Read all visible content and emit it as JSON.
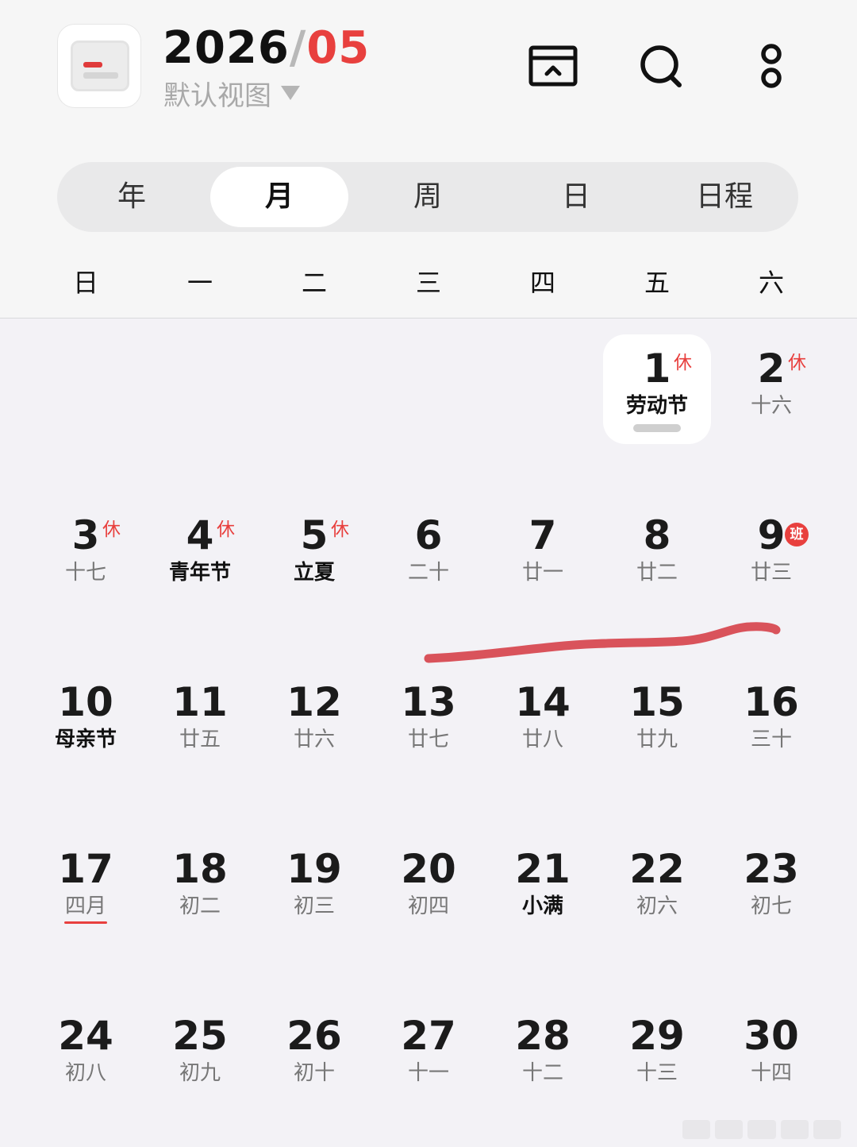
{
  "header": {
    "year": "2026",
    "separator": "/",
    "month": "05",
    "view_label": "默认视图",
    "buttons": [
      {
        "name": "collapse-icon"
      },
      {
        "name": "search-icon"
      },
      {
        "name": "more-icon"
      }
    ]
  },
  "view_tabs": [
    {
      "label": "年",
      "active": false
    },
    {
      "label": "月",
      "active": true
    },
    {
      "label": "周",
      "active": false
    },
    {
      "label": "日",
      "active": false
    },
    {
      "label": "日程",
      "active": false
    }
  ],
  "weekdays": [
    "日",
    "一",
    "二",
    "三",
    "四",
    "五",
    "六"
  ],
  "days": [
    {
      "day": "1",
      "sub": "劳动节",
      "badge": "休",
      "festival": true,
      "selected": true
    },
    {
      "day": "2",
      "sub": "十六",
      "badge": "休"
    },
    {
      "day": "3",
      "sub": "十七",
      "badge": "休"
    },
    {
      "day": "4",
      "sub": "青年节",
      "badge": "休",
      "festival": true
    },
    {
      "day": "5",
      "sub": "立夏",
      "badge": "休",
      "festival": true
    },
    {
      "day": "6",
      "sub": "二十"
    },
    {
      "day": "7",
      "sub": "廿一"
    },
    {
      "day": "8",
      "sub": "廿二"
    },
    {
      "day": "9",
      "sub": "廿三",
      "badge": "班",
      "badge_type": "ban"
    },
    {
      "day": "10",
      "sub": "母亲节",
      "festival": true
    },
    {
      "day": "11",
      "sub": "廿五"
    },
    {
      "day": "12",
      "sub": "廿六"
    },
    {
      "day": "13",
      "sub": "廿七"
    },
    {
      "day": "14",
      "sub": "廿八"
    },
    {
      "day": "15",
      "sub": "廿九"
    },
    {
      "day": "16",
      "sub": "三十"
    },
    {
      "day": "17",
      "sub": "四月",
      "month_start": true
    },
    {
      "day": "18",
      "sub": "初二"
    },
    {
      "day": "19",
      "sub": "初三"
    },
    {
      "day": "20",
      "sub": "初四"
    },
    {
      "day": "21",
      "sub": "小满",
      "festival": true
    },
    {
      "day": "22",
      "sub": "初六"
    },
    {
      "day": "23",
      "sub": "初七"
    },
    {
      "day": "24",
      "sub": "初八"
    },
    {
      "day": "25",
      "sub": "初九"
    },
    {
      "day": "26",
      "sub": "初十"
    },
    {
      "day": "27",
      "sub": "十一"
    },
    {
      "day": "28",
      "sub": "十二"
    },
    {
      "day": "29",
      "sub": "十三"
    },
    {
      "day": "30",
      "sub": "十四"
    }
  ],
  "first_weekday_index": 5,
  "colors": {
    "accent": "#e8403e",
    "handwriting": "#d9535b",
    "background": "#f3f2f6"
  }
}
